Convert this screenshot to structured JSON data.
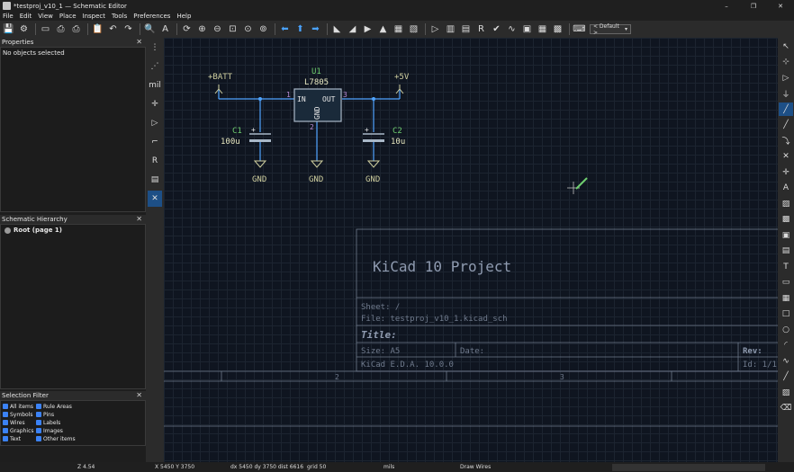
{
  "window": {
    "title": "*testproj_v10_1 — Schematic Editor",
    "controls": [
      "–",
      "❐",
      "✕"
    ]
  },
  "menu": [
    "File",
    "Edit",
    "View",
    "Place",
    "Inspect",
    "Tools",
    "Preferences",
    "Help"
  ],
  "toolbar": {
    "zoom_select": "< Default >"
  },
  "properties": {
    "header": "Properties",
    "body": "No objects selected"
  },
  "hierarchy": {
    "header": "Schematic Hierarchy",
    "root": "Root (page 1)"
  },
  "selection_filter": {
    "header": "Selection Filter",
    "items": [
      "All items",
      "Rule Areas",
      "Symbols",
      "Pins",
      "Wires",
      "Labels",
      "Graphics",
      "Images",
      "Text",
      "Other items"
    ]
  },
  "left_toolbar": {
    "units_label": "mil"
  },
  "schematic": {
    "power_batt": "+BATT",
    "power_5v": "+5V",
    "u1_ref": "U1",
    "u1_value": "L7805",
    "pin_in": "IN",
    "pin_out": "OUT",
    "pin_gnd": "GND",
    "pin1": "1",
    "pin2": "2",
    "pin3": "3",
    "c1_ref": "C1",
    "c1_value": "100u",
    "c2_ref": "C2",
    "c2_value": "10u",
    "plus": "+",
    "gnd1": "GND",
    "gnd2": "GND",
    "gnd3": "GND"
  },
  "title_block": {
    "project": "KiCad 10 Project",
    "sheet": "Sheet: /",
    "file": "File: testproj_v10_1.kicad_sch",
    "title": "Title:",
    "size": "Size: A5",
    "date": "Date:",
    "rev": "Rev:",
    "tool": "KiCad E.D.A. 10.0.0",
    "id": "Id: 1/1",
    "col2": "2",
    "col3": "3"
  },
  "status": {
    "zoom": "Z 4.54",
    "xy": "X 5450  Y 3750",
    "delta": "dx 5450  dy 3750  dist 6616",
    "grid": "grid 50",
    "units": "mils",
    "mode": "Draw Wires"
  },
  "colors": {
    "wire": "#4fa4ff",
    "symbol_body": "#a9b8c8",
    "ref_text": "#6fce6f",
    "value_text": "#e8e8c0",
    "pin_num": "#b98bd6",
    "sheet_frame": "#6f7a8c",
    "power": "#d0d0a0"
  }
}
